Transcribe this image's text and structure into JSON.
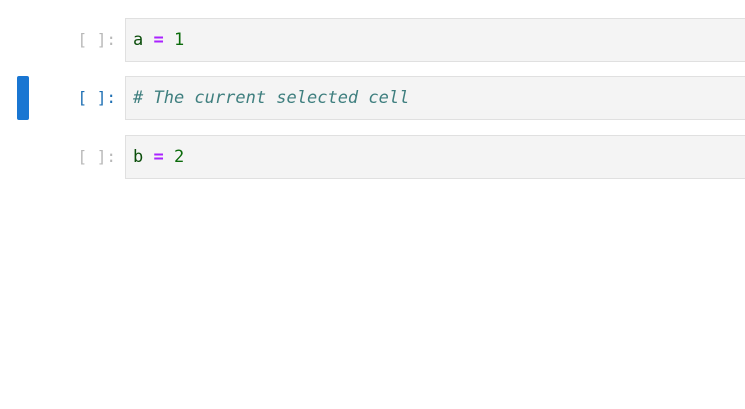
{
  "cells": [
    {
      "prompt": "[ ]:",
      "selected": false,
      "code": {
        "var": "a",
        "op": "=",
        "num": "1"
      }
    },
    {
      "prompt": "[ ]:",
      "selected": true,
      "code": {
        "comment": "# The current selected cell"
      }
    },
    {
      "prompt": "[ ]:",
      "selected": false,
      "code": {
        "var": "b",
        "op": "=",
        "num": "2"
      }
    }
  ],
  "colors": {
    "selection_bar": "#1976d2",
    "selected_prompt": "#1e6fb3",
    "prompt": "#b8b8b8",
    "editor_bg": "#f4f4f4",
    "operator": "#aa22ff",
    "number": "#0b6b0b",
    "comment": "#3f7f7f"
  }
}
